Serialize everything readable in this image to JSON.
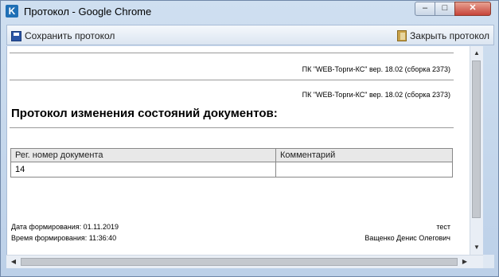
{
  "window": {
    "title": "Протокол - Google Chrome",
    "app_icon_letter": "K",
    "minimize_glyph": "–",
    "maximize_glyph": "□",
    "close_glyph": "✕"
  },
  "toolbar": {
    "save_label": "Сохранить протокол",
    "close_label": "Закрыть протокол"
  },
  "document": {
    "version_header_1": "ПК \"WEB-Торги-КС\" вер. 18.02 (сборка 2373)",
    "version_header_2": "ПК \"WEB-Торги-КС\" вер. 18.02 (сборка 2373)",
    "heading": "Протокол изменения состояний документов:",
    "table": {
      "columns": [
        "Рег. номер документа",
        "Комментарий"
      ],
      "rows": [
        [
          "14",
          ""
        ]
      ]
    },
    "footer": {
      "date_label": "Дата формирования: 01.11.2019",
      "time_label": "Время формирования: 11:36:40",
      "user_login": "тест",
      "user_name": "Ващенко Денис Олегович"
    }
  },
  "scrollbars": {
    "up_glyph": "▲",
    "down_glyph": "▼",
    "left_glyph": "◀",
    "right_glyph": "▶"
  }
}
